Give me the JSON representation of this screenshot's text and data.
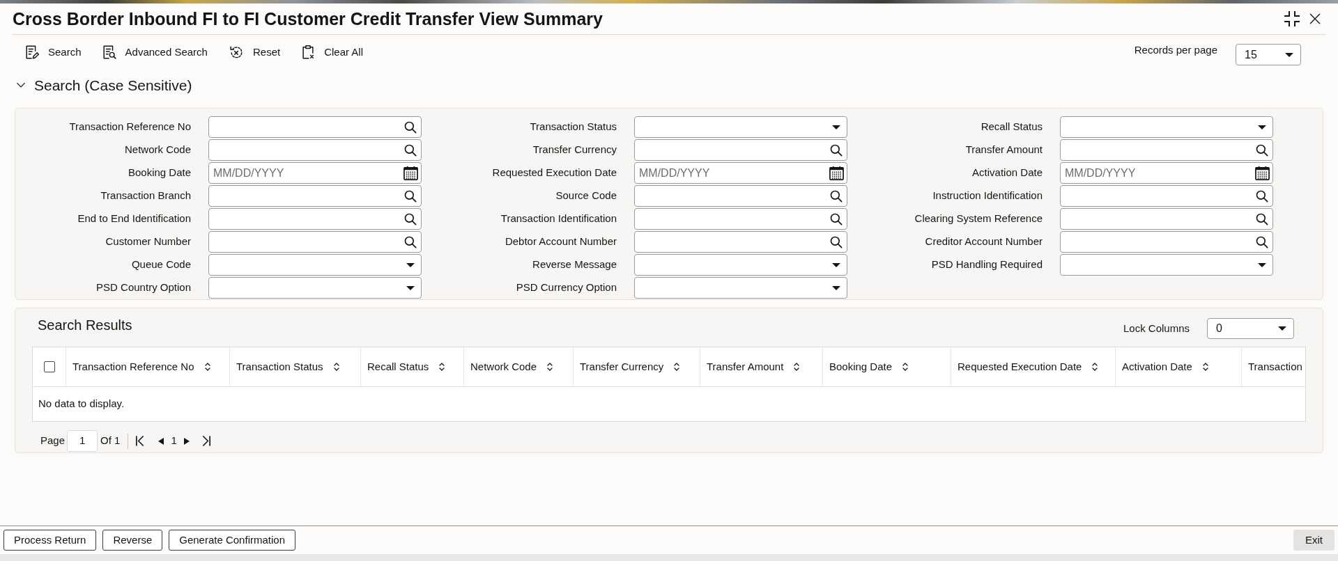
{
  "window": {
    "title": "Cross Border Inbound FI to FI Customer Credit Transfer View Summary"
  },
  "toolbar": [
    {
      "label": "Search"
    },
    {
      "label": "Advanced Search"
    },
    {
      "label": "Reset"
    },
    {
      "label": "Clear All"
    }
  ],
  "records_per_page": {
    "label": "Records per page",
    "value": "15"
  },
  "search_section": {
    "title": "Search (Case Sensitive)",
    "expanded": true,
    "fields": [
      {
        "label": "Transaction Reference No",
        "kind": "lookup"
      },
      {
        "label": "Transaction Status",
        "kind": "select"
      },
      {
        "label": "Recall Status",
        "kind": "select"
      },
      {
        "label": "Network Code",
        "kind": "lookup"
      },
      {
        "label": "Transfer Currency",
        "kind": "lookup"
      },
      {
        "label": "Transfer Amount",
        "kind": "lookup"
      },
      {
        "label": "Booking Date",
        "kind": "date",
        "placeholder": "MM/DD/YYYY"
      },
      {
        "label": "Requested Execution Date",
        "kind": "date",
        "placeholder": "MM/DD/YYYY"
      },
      {
        "label": "Activation Date",
        "kind": "date",
        "placeholder": "MM/DD/YYYY"
      },
      {
        "label": "Transaction Branch",
        "kind": "lookup"
      },
      {
        "label": "Source Code",
        "kind": "lookup"
      },
      {
        "label": "Instruction Identification",
        "kind": "lookup"
      },
      {
        "label": "End to End Identification",
        "kind": "lookup"
      },
      {
        "label": "Transaction Identification",
        "kind": "lookup"
      },
      {
        "label": "Clearing System Reference",
        "kind": "lookup"
      },
      {
        "label": "Customer Number",
        "kind": "lookup"
      },
      {
        "label": "Debtor Account Number",
        "kind": "lookup"
      },
      {
        "label": "Creditor Account Number",
        "kind": "lookup"
      },
      {
        "label": "Queue Code",
        "kind": "select"
      },
      {
        "label": "Reverse Message",
        "kind": "select"
      },
      {
        "label": "PSD Handling Required",
        "kind": "select"
      },
      {
        "label": "PSD Country Option",
        "kind": "select"
      },
      {
        "label": "PSD Currency Option",
        "kind": "select"
      }
    ]
  },
  "search_results": {
    "title": "Search Results",
    "lock_columns": {
      "label": "Lock Columns",
      "value": "0"
    },
    "select_all": {
      "checked": false
    },
    "columns": [
      "Transaction Reference No",
      "Transaction Status",
      "Recall Status",
      "Network Code",
      "Transfer Currency",
      "Transfer Amount",
      "Booking Date",
      "Requested Execution Date",
      "Activation Date",
      "Transaction"
    ],
    "empty_message": "No data to display.",
    "pagination": {
      "page_label": "Page",
      "page_value": "1",
      "of_label": "Of 1",
      "current_page": "1"
    }
  },
  "footer": {
    "buttons": [
      "Process Return",
      "Reverse",
      "Generate Confirmation"
    ],
    "exit": "Exit"
  }
}
